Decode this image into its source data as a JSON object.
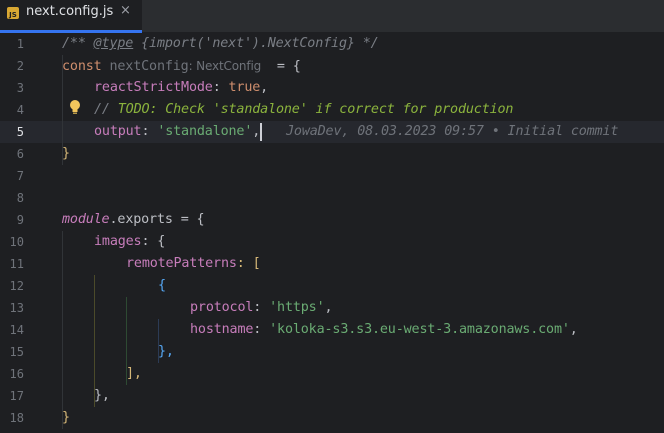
{
  "tab": {
    "file_name": "next.config.js",
    "icon_text": "JS",
    "close_glyph": "×"
  },
  "lines": {
    "n1": "1",
    "n2": "2",
    "n3": "3",
    "n4": "4",
    "n5": "5",
    "n6": "6",
    "n7": "7",
    "n8": "8",
    "n9": "9",
    "n10": "10",
    "n11": "11",
    "n12": "12",
    "n13": "13",
    "n14": "14",
    "n15": "15",
    "n16": "16",
    "n17": "17",
    "n18": "18"
  },
  "code": {
    "l1_open": "/** ",
    "l1_tag": "@type",
    "l1_type_open": " {import(",
    "l1_type_str": "'next'",
    "l1_type_close": ").NextConfig}",
    "l1_close": " */",
    "l2_const": "const",
    "l2_name": " nextConfig",
    "l2_hint": ": NextConfig",
    "l2_rest": "  = {",
    "l3_prop": "reactStrictMode",
    "l3_colon": ": ",
    "l3_val": "true",
    "l3_comma": ",",
    "l4_slashes": "// ",
    "l4_todo": "TODO: Check 'standalone' if correct for production",
    "l5_prop": "output",
    "l5_colon": ": ",
    "l5_val": "'standalone'",
    "l5_comma": ",",
    "l5_blame": "JowaDev, 08.03.2023 09:57 • Initial commit",
    "l6": "}",
    "l9_module": "module",
    "l9_dot": ".",
    "l9_exports": "exports",
    "l9_rest": " = {",
    "l10_prop": "images",
    "l10_rest": ": {",
    "l11_prop": "remotePatterns",
    "l11_rest": ": [",
    "l12": "{",
    "l13_prop": "protocol",
    "l13_colon": ": ",
    "l13_val": "'https'",
    "l13_comma": ",",
    "l14_prop": "hostname",
    "l14_colon": ": ",
    "l14_val": "'koloka-s3.s3.eu-west-3.amazonaws.com'",
    "l14_comma": ",",
    "l15": "},",
    "l16": "],",
    "l17": "},",
    "l18": "}"
  },
  "colors": {
    "background": "#1e1f22",
    "keyword": "#cf8e6d",
    "property": "#c77dbb",
    "string": "#6aab73",
    "todo": "#8bb33d",
    "tab_accent": "#3574f0"
  },
  "icons": {
    "intention": "lightbulb-icon",
    "file": "js-file-icon"
  }
}
